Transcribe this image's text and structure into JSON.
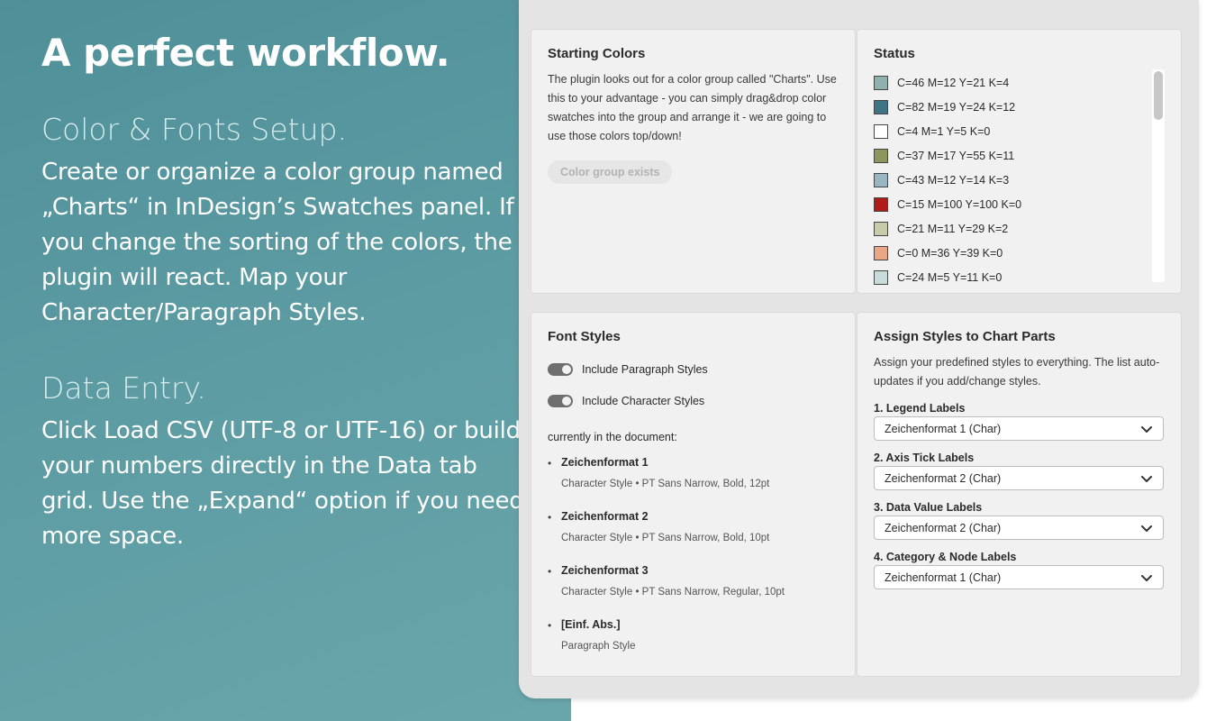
{
  "marketing": {
    "headline": "A perfect workflow.",
    "sections": [
      {
        "title": "Color & Fonts Setup.",
        "body": "Create or organize a color group named „Charts“ in InDesign’s Swatches panel. If you change the sorting of the colors, the plugin will react. Map your Character/Paragraph Styles."
      },
      {
        "title": "Data Entry.",
        "body": "Click Load CSV (UTF-8 or UTF-16) or build your numbers directly in the Data tab grid. Use the „Expand“ option if you need more space."
      }
    ]
  },
  "starting_colors": {
    "title": "Starting Colors",
    "description": "The plugin looks out for a color group called \"Charts\". Use this to your advantage - you can simply drag&drop color swatches into the group and arrange it - we are going to use those colors top/down!",
    "button_label": "Color group exists"
  },
  "status": {
    "title": "Status",
    "swatches": [
      {
        "label": "C=46 M=12 Y=21 K=4",
        "color": "#8fb1b0"
      },
      {
        "label": "C=82 M=19 Y=24 K=12",
        "color": "#3f7485"
      },
      {
        "label": "C=4 M=1 Y=5 K=0",
        "color": "#ffffff"
      },
      {
        "label": "C=37 M=17 Y=55 K=11",
        "color": "#8d975d"
      },
      {
        "label": "C=43 M=12 Y=14 K=3",
        "color": "#98b6c1"
      },
      {
        "label": "C=15 M=100 Y=100 K=0",
        "color": "#b01c17"
      },
      {
        "label": "C=21 M=11 Y=29 K=2",
        "color": "#c9cba8"
      },
      {
        "label": "C=0 M=36 Y=39 K=0",
        "color": "#e9a786"
      },
      {
        "label": "C=24 M=5 Y=11 K=0",
        "color": "#c8dcdb"
      }
    ]
  },
  "font_styles": {
    "title": "Font Styles",
    "toggles": [
      {
        "label": "Include Paragraph Styles",
        "on": true
      },
      {
        "label": "Include Character Styles",
        "on": true
      }
    ],
    "document_label": "currently in the document:",
    "styles": [
      {
        "name": "Zeichenformat 1",
        "meta": "Character Style • PT Sans Narrow, Bold, 12pt"
      },
      {
        "name": "Zeichenformat 2",
        "meta": "Character Style • PT Sans Narrow, Bold, 10pt"
      },
      {
        "name": "Zeichenformat 3",
        "meta": "Character Style • PT Sans Narrow, Regular, 10pt"
      },
      {
        "name": "[Einf. Abs.]",
        "meta": "Paragraph Style"
      }
    ]
  },
  "assign": {
    "title": "Assign Styles to Chart Parts",
    "description": "Assign your predefined styles to everything. The list auto-updates if you add/change styles.",
    "fields": [
      {
        "label": "1. Legend Labels",
        "value": "Zeichenformat 1 (Char)"
      },
      {
        "label": "2. Axis Tick Labels",
        "value": "Zeichenformat 2 (Char)"
      },
      {
        "label": "3. Data Value Labels",
        "value": "Zeichenformat 2 (Char)"
      },
      {
        "label": "4. Category & Node Labels",
        "value": "Zeichenformat 1 (Char)"
      }
    ]
  }
}
